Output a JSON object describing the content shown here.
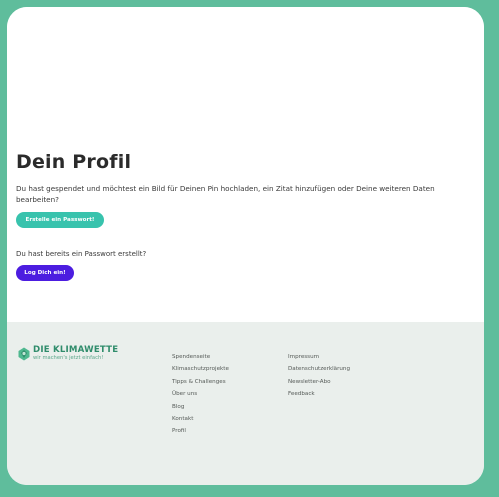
{
  "profile": {
    "title": "Dein Profil",
    "intro": "Du hast gespendet und möchtest ein Bild für Deinen Pin hochladen, ein Zitat hinzufügen oder Deine weiteren Daten bearbeiten?",
    "create_password_button": "Erstelle ein Passwort!",
    "password_question": "Du hast bereits ein Passwort erstellt?",
    "login_button": "Log Dich ein!"
  },
  "footer": {
    "logo_name": "DIE KLIMAWETTE",
    "logo_tagline": "wir machen's jetzt einfach!",
    "links_col1": [
      {
        "label": "Spendenseite"
      },
      {
        "label": "Klimaschutzprojekte"
      },
      {
        "label": "Tipps & Challenges"
      },
      {
        "label": "Über uns"
      },
      {
        "label": "Blog"
      },
      {
        "label": "Kontakt"
      },
      {
        "label": "Profil"
      }
    ],
    "links_col2": [
      {
        "label": "Impressum"
      },
      {
        "label": "Datenschutzerklärung"
      },
      {
        "label": "Newsletter-Abo"
      },
      {
        "label": "Feedback"
      }
    ]
  },
  "colors": {
    "frame": "#5fbd9c",
    "primary_teal": "#38c3ad",
    "primary_purple": "#4c1de0",
    "footer_bg": "#eaefec",
    "logo_green": "#2f8c6b"
  },
  "icons": {
    "logo": "globe-leaf-icon"
  }
}
